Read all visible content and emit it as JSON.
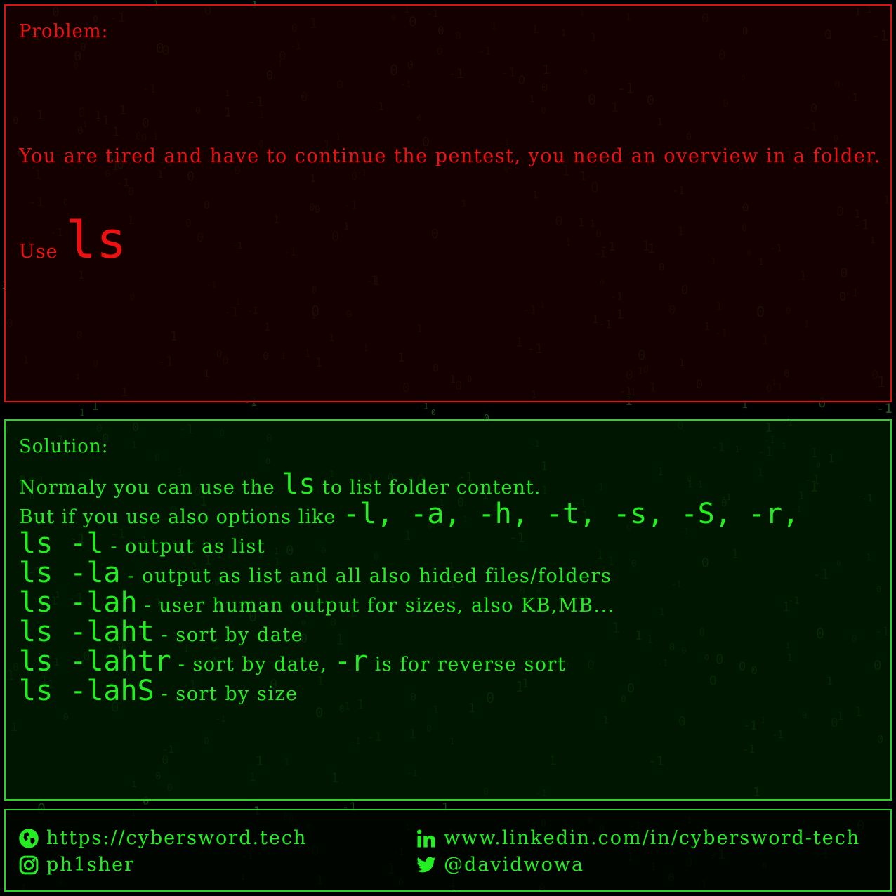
{
  "colors": {
    "problem_accent": "#ee1111",
    "solution_accent": "#22ee22"
  },
  "problem": {
    "heading": "Problem:",
    "text": "You are tired and have to continue the pentest, you need an overview in a folder.",
    "use_label": "Use",
    "use_command": "ls"
  },
  "solution": {
    "heading": "Solution:",
    "line1": {
      "pre": "Normaly you can use the",
      "cmd": "ls",
      "post": "to list folder content."
    },
    "line2": {
      "pre": "But if you use also options like",
      "options": "-l, -a, -h, -t, -s, -S, -r,"
    },
    "commands": [
      {
        "cmd": "ls -l",
        "desc": "- output as list"
      },
      {
        "cmd": "ls -la",
        "desc": "- output as list and all also hided files/folders"
      },
      {
        "cmd": "ls -lah",
        "desc": "- user human output for sizes, also KB,MB..."
      },
      {
        "cmd": "ls -laht",
        "desc": "- sort by date"
      },
      {
        "cmd": "ls -lahtr",
        "desc": "- sort by date,",
        "extra_cmd": "-r",
        "extra_desc": "is for reverse sort"
      },
      {
        "cmd": "ls -lahS",
        "desc": "- sort by size"
      }
    ]
  },
  "footer": {
    "website": {
      "icon": "globe-icon",
      "text": "https://cybersword.tech"
    },
    "instagram": {
      "icon": "instagram-icon",
      "text": "ph1sher"
    },
    "linkedin": {
      "icon": "linkedin-icon",
      "text": "www.linkedin.com/in/cybersword-tech"
    },
    "twitter": {
      "icon": "twitter-icon",
      "text": "@davidwowa"
    }
  }
}
